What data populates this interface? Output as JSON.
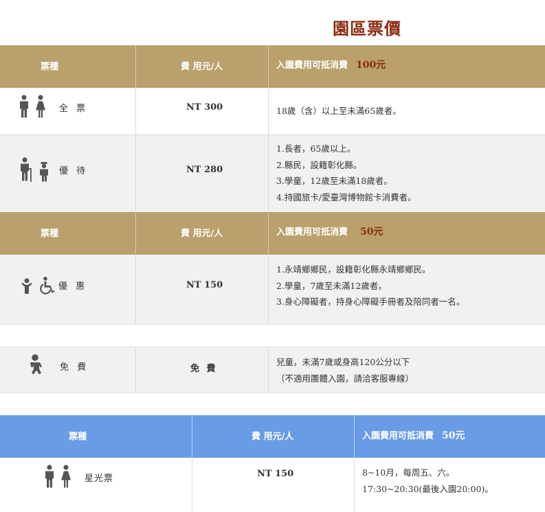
{
  "page": {
    "title": "園區票價"
  },
  "colors": {
    "gold_header": "#b9a06c",
    "blue_header": "#6a9be6",
    "accent_red": "#8b2a10",
    "icon_gray": "#555555"
  },
  "section1": {
    "header": {
      "col1": "票種",
      "col2": "費 用元/人",
      "col3": "入園費用可抵消費",
      "note": "100元"
    },
    "rows": [
      {
        "label": "全 票",
        "icons": [
          "man-icon",
          "woman-icon"
        ],
        "price": "NT 300",
        "lines": [
          "18歲（含）以上至未滿65歲者。"
        ]
      },
      {
        "label": "優 待",
        "icons": [
          "elder-icon",
          "student-icon"
        ],
        "price": "NT 280",
        "lines": [
          "1.長者，65歲以上。",
          "2.縣民，設籍彰化縣。",
          "3.學童，12歲至未滿18歲者。",
          "4.持國旅卡/愛臺灣博物館卡消費者。"
        ]
      }
    ]
  },
  "section2": {
    "header": {
      "col1": "票種",
      "col2": "費 用元/人",
      "col3": "入園費用可抵消費",
      "note": "50元"
    },
    "rows": [
      {
        "label": "優 惠",
        "icons": [
          "child-icon",
          "wheelchair-icon"
        ],
        "price": "NT 150",
        "lines": [
          "1.永靖鄉鄉民，設籍彰化縣永靖鄉鄉民。",
          "2.學童，7歲至未滿12歲者。",
          "3.身心障礙者，持身心障礙手冊者及陪同者一名。"
        ]
      }
    ]
  },
  "section3": {
    "rows": [
      {
        "label": "免 費",
        "icons": [
          "baby-icon"
        ],
        "price": "免 費",
        "lines": [
          "兒童，未滿7歲或身高120公分以下",
          "（不適用團體入園，請洽客服專線）"
        ]
      }
    ]
  },
  "section4": {
    "header": {
      "col1": "票種",
      "col2": "費 用元/人",
      "col3": "入園費用可抵消費",
      "note": "50元"
    },
    "rows": [
      {
        "label": "星光票",
        "icons": [
          "man-icon",
          "woman-icon"
        ],
        "price": "NT 150",
        "lines": [
          "8~10月，每周五、六。",
          "17:30~20:30(最後入園20:00)。"
        ]
      }
    ]
  }
}
